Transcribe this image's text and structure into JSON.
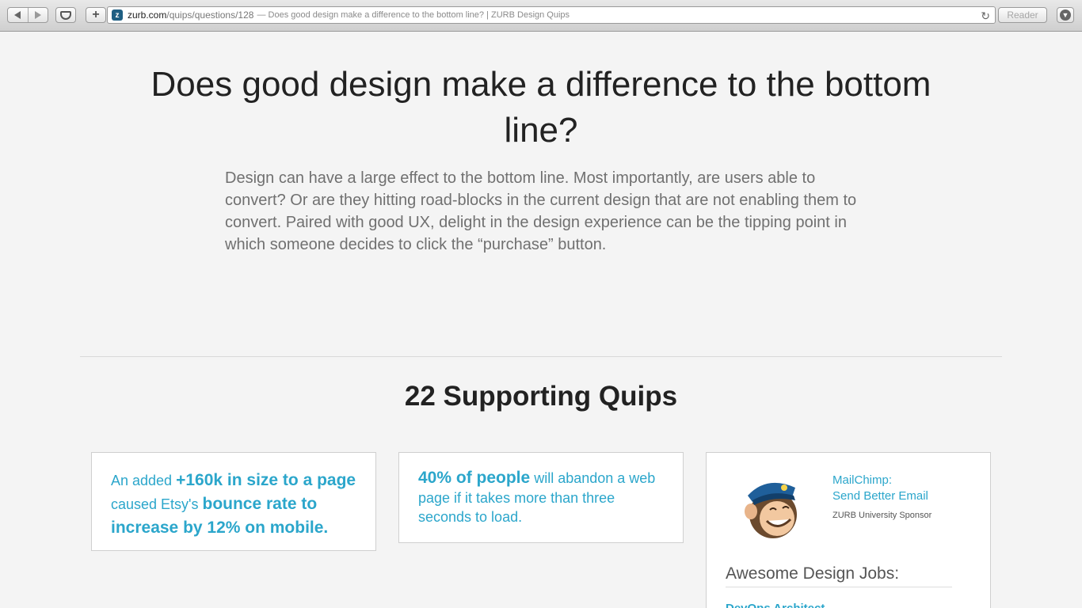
{
  "browser": {
    "url_domain": "zurb.com",
    "url_path": "/quips/questions/128",
    "url_title": "— Does good design make a difference to the bottom line? | ZURB Design Quips",
    "favicon_letter": "z",
    "reader_label": "Reader",
    "add_label": "+",
    "reload_icon": "reload-icon"
  },
  "page": {
    "headline": "Does good design make a difference to the bottom line?",
    "lead": "Design can have a large effect to the bottom line. Most importantly, are users able to convert? Or are they hitting road-blocks in the current design that are not enabling them to convert. Paired with good UX, delight in the design experience can be the tipping point in which someone decides to click the “purchase” button.",
    "supporting_title": "22 Supporting Quips"
  },
  "quips": [
    {
      "p1": "An added ",
      "b1": "+160k in size to a page",
      "p2": " caused Etsy's ",
      "b2": "bounce rate to increase by 12% on mobile."
    },
    {
      "b1": "40% of people",
      "p1": " will abandon a web page if it takes more than three seconds to load."
    }
  ],
  "sponsor": {
    "link_line1": "MailChimp:",
    "link_line2": "Send Better Email",
    "note": "ZURB University Sponsor",
    "jobs_title": "Awesome Design Jobs:",
    "job_partial": "DevOps Architect"
  },
  "colors": {
    "accent": "#2ba6cb",
    "background": "#f4f4f4"
  }
}
